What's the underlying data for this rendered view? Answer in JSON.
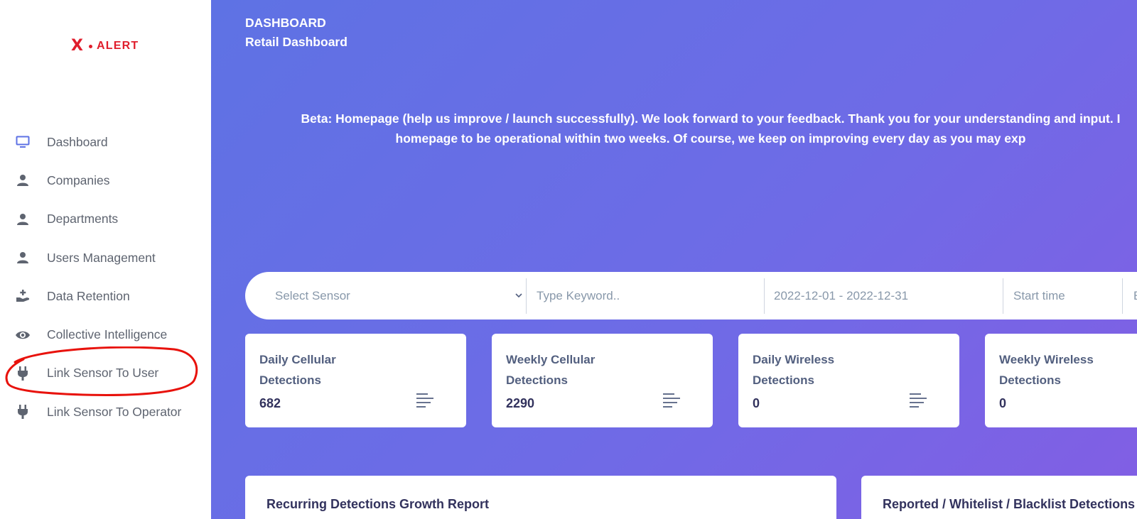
{
  "brand": {
    "logo_x": "X",
    "logo_text": "ALERT",
    "color": "#e01e2c"
  },
  "sidebar": {
    "items": [
      {
        "label": "Dashboard",
        "icon": "monitor-icon",
        "active": true
      },
      {
        "label": "Companies",
        "icon": "user-icon"
      },
      {
        "label": "Departments",
        "icon": "user-icon"
      },
      {
        "label": "Users Management",
        "icon": "user-icon"
      },
      {
        "label": "Data Retention",
        "icon": "hand-plus-icon"
      },
      {
        "label": "Collective Intelligence",
        "icon": "eye-icon"
      },
      {
        "label": "Link Sensor To User",
        "icon": "plug-icon",
        "annotated": true
      },
      {
        "label": "Link Sensor To Operator",
        "icon": "plug-icon"
      }
    ]
  },
  "header": {
    "breadcrumb": "DASHBOARD",
    "title": "Retail Dashboard",
    "beta_line1": "Beta: Homepage (help us improve / launch successfully). We look forward to your feedback. Thank you for your understanding and input. I",
    "beta_line2": "homepage to be operational within two weeks. Of course, we keep on improving every day as you may exp"
  },
  "filters": {
    "sensor_select": "Select Sensor",
    "keyword_placeholder": "Type Keyword..",
    "date_range": "2022-12-01 - 2022-12-31",
    "start_time_placeholder": "Start time",
    "end_time_placeholder": "E"
  },
  "stats": [
    {
      "title_line1": "Daily Cellular",
      "title_line2": "Detections",
      "value": "682"
    },
    {
      "title_line1": "Weekly Cellular",
      "title_line2": "Detections",
      "value": "2290"
    },
    {
      "title_line1": "Daily Wireless",
      "title_line2": "Detections",
      "value": "0"
    },
    {
      "title_line1": "Weekly Wireless",
      "title_line2": "Detections",
      "value": "0"
    }
  ],
  "panels": {
    "recurring_title": "Recurring Detections Growth Report",
    "reported_title": "Reported / Whitelist / Blacklist Detections"
  },
  "colors": {
    "accent": "#5e72e4",
    "gradient_end": "#825ee4",
    "annotation": "#e8120c",
    "muted_text": "#5e6470"
  }
}
